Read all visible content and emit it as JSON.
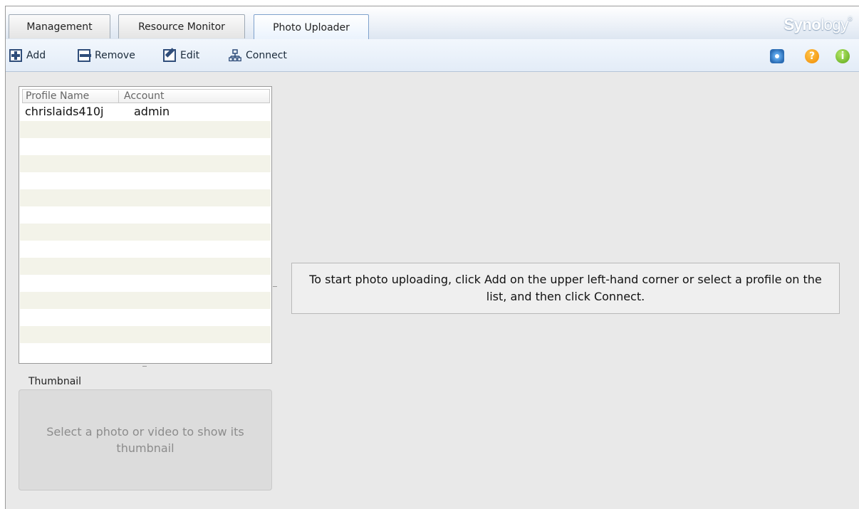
{
  "tabs": [
    {
      "label": "Management"
    },
    {
      "label": "Resource Monitor"
    },
    {
      "label": "Photo Uploader",
      "active": true
    }
  ],
  "logo": {
    "text_bold": "Syno",
    "text_light": "logy",
    "mark": "®"
  },
  "toolbar": {
    "add_label": "Add",
    "remove_label": "Remove",
    "edit_label": "Edit",
    "connect_label": "Connect",
    "right_icons": [
      "gear-icon",
      "help-icon",
      "info-icon"
    ],
    "help_glyph": "?",
    "info_glyph": "i"
  },
  "profiles": {
    "columns": [
      "Profile Name",
      "Account"
    ],
    "rows": [
      {
        "profile_name": "chrislaids410j",
        "account": "admin"
      }
    ]
  },
  "thumbnail": {
    "label": "Thumbnail",
    "placeholder": "Select a photo or video to show its thumbnail"
  },
  "message": "To start photo uploading, click Add on the upper left-hand corner or select a profile on the list, and then click Connect.",
  "colors": {
    "accent": "#7fa2cd",
    "toolbar_bg": "#e3ecf7",
    "row_alt": "#f3f3e9",
    "help": "#f08a00",
    "info": "#5aa617"
  }
}
